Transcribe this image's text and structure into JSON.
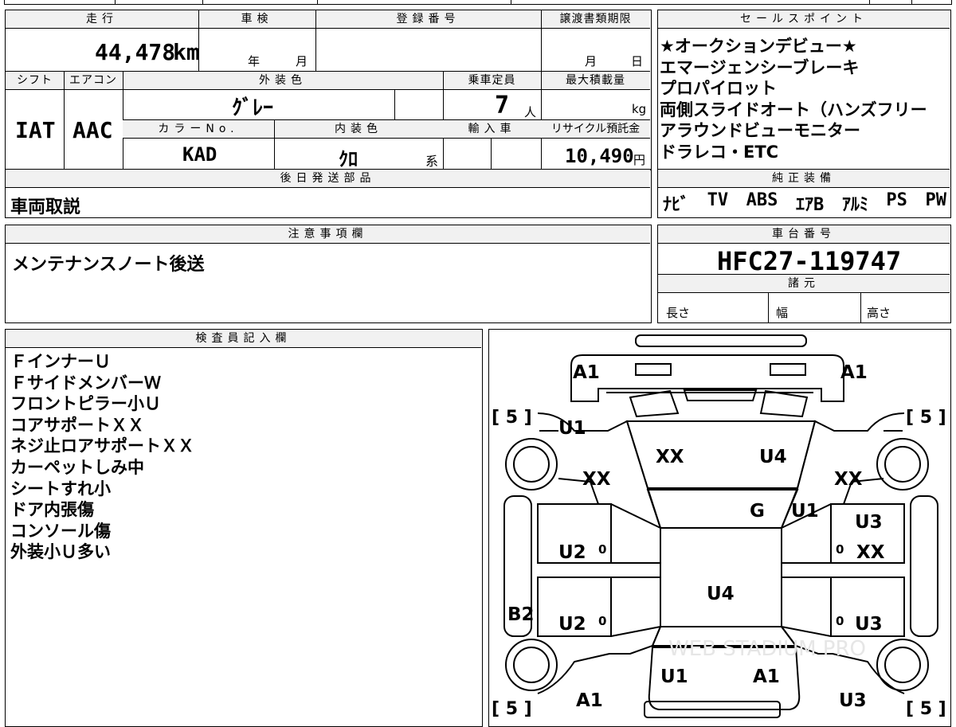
{
  "headers": {
    "mileage": "走行",
    "shaken": "車検",
    "registration": "登録番号",
    "transfer_deadline": "譲渡書類期限",
    "sales_points": "セールスポイント",
    "shift": "シフト",
    "aircon": "エアコン",
    "exterior_color": "外装色",
    "capacity": "乗車定員",
    "max_load": "最大積載量",
    "color_no": "カラーNo.",
    "interior_color": "内装色",
    "import": "輸入車",
    "recycle": "リサイクル預託金",
    "later_parts": "後日発送部品",
    "genuine_equipment": "純正装備",
    "notes": "注意事項欄",
    "chassis_no": "車台番号",
    "specs": "諸元",
    "inspector": "検査員記入欄"
  },
  "values": {
    "mileage_num": "44,478",
    "mileage_unit": "km",
    "shaken_year": "年",
    "shaken_month": "月",
    "transfer_month": "月",
    "transfer_day": "日",
    "shift": "IAT",
    "aircon": "AAC",
    "exterior_color": "ｸﾞﾚｰ",
    "capacity_num": "7",
    "capacity_unit": "人",
    "max_load_unit": "kg",
    "color_no": "KAD",
    "interior_color": "ｸﾛ",
    "interior_suffix": "系",
    "recycle_num": "10,490",
    "recycle_unit": "円",
    "later_parts": "車両取説",
    "notes": "メンテナンスノート後送",
    "chassis_no": "HFC27-119747",
    "spec_length": "長さ",
    "spec_width": "幅",
    "spec_height": "高さ"
  },
  "sales_points": [
    "★オークションデビュー★",
    "エマージェンシーブレーキ",
    "プロパイロット",
    "両側スライドオート（ハンズフリー",
    "アラウンドビューモニター",
    "ドラレコ・ETC"
  ],
  "equipment": [
    "ﾅﾋﾞ",
    "TV",
    "ABS",
    "ｴｱB",
    "ｱﾙﾐ",
    "PS",
    "PW"
  ],
  "inspector_notes": [
    "ＦインナーＵ",
    "ＦサイドメンバーＷ",
    "フロントピラー小Ｕ",
    "コアサポートＸＸ",
    "ネジ止ロアサポートＸＸ",
    "カーペットしみ中",
    "シートすれ小",
    "ドア内張傷",
    "コンソール傷",
    "外装小Ｕ多い"
  ],
  "diagram": {
    "marks": {
      "a1_fl": "A1",
      "a1_fr": "A1",
      "u1_fl": "U1",
      "xx_fl": "XX",
      "xx_hood": "XX",
      "u4_hood": "U4",
      "xx_fr": "XX",
      "g_glass": "G",
      "u1_fr": "U1",
      "u3_r1": "U3",
      "xx_r": "XX",
      "u2_l1": "U2",
      "u4_roof": "U4",
      "b2_l": "B2",
      "u2_l2": "U2",
      "u3_r2": "U3",
      "u1_rear": "U1",
      "a1_rear": "A1",
      "a1_rl": "A1",
      "u3_rr": "U3"
    },
    "tire_tl": "[ 5 ]",
    "tire_tr": "[ 5 ]",
    "tire_bl": "[ 5 ]",
    "tire_br": "[ 5 ]",
    "zero": "0",
    "watermark": "WEB STADIUM PRO"
  }
}
